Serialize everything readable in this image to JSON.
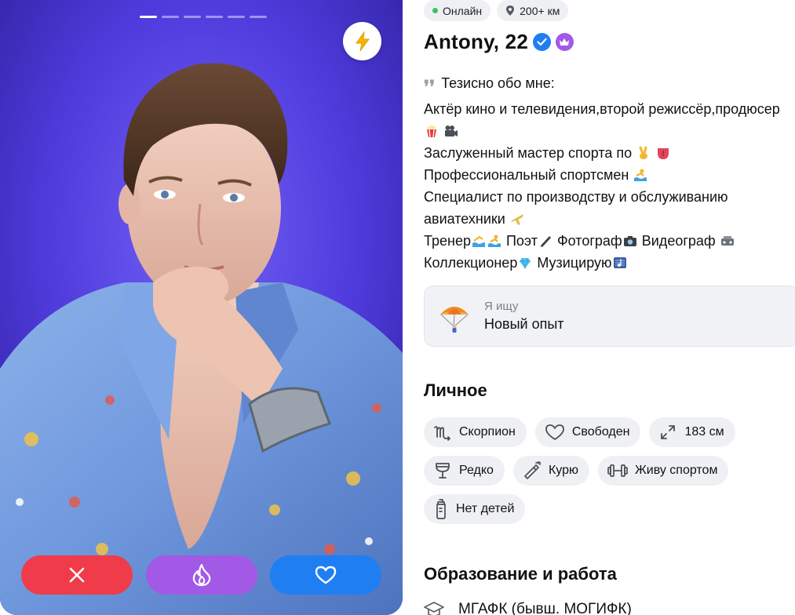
{
  "photo": {
    "total_photos": 6,
    "active_photo": 1,
    "boost_icon": "lightning-icon",
    "actions": {
      "dislike_icon": "close-icon",
      "superlike_icon": "flame-icon",
      "like_icon": "heart-icon"
    }
  },
  "status": {
    "online_label": "Онлайн",
    "distance_label": "200+ км"
  },
  "profile": {
    "name_age": "Antony, 22",
    "verified": true,
    "premium": true
  },
  "bio": {
    "heading": "Тезисно обо мне:",
    "lines": [
      "Актёр кино и телевидения,второй режиссёр,продюсер",
      "Заслуженный мастер спорта по",
      "Профессиональный спортсмен",
      "Специалист по производству и обслуживанию",
      "авиатехники",
      "Тренер",
      "Поэт",
      "Фотограф",
      "Видеограф",
      "Коллекционер",
      "Музицирую"
    ]
  },
  "seeking": {
    "label": "Я ищу",
    "value": "Новый опыт",
    "icon": "parachute-icon"
  },
  "personal": {
    "title": "Личное",
    "tags": [
      {
        "label": "Скорпион",
        "icon": "scorpio-icon"
      },
      {
        "label": "Свободен",
        "icon": "heart-outline-icon"
      },
      {
        "label": "183 см",
        "icon": "expand-icon"
      },
      {
        "label": "Редко",
        "icon": "wine-glass-icon"
      },
      {
        "label": "Курю",
        "icon": "cigarette-icon"
      },
      {
        "label": "Живу спортом",
        "icon": "dumbbell-icon"
      },
      {
        "label": "Нет детей",
        "icon": "baby-bottle-icon"
      }
    ]
  },
  "education": {
    "title": "Образование и работа",
    "school": "МГАФК (бывш. МОГИФК)",
    "icon": "graduation-cap-icon"
  },
  "colors": {
    "photo_background": "#5a45e6",
    "dislike": "#f03c4a",
    "superlike": "#a259e6",
    "like": "#1f7ff2",
    "online_dot": "#35c463",
    "chip_bg": "#eff0f3"
  }
}
